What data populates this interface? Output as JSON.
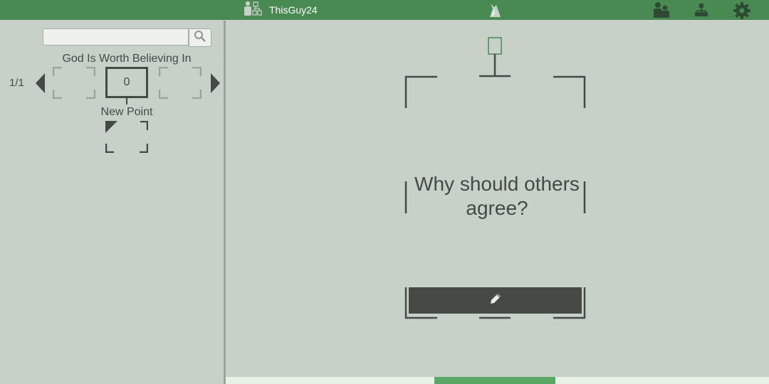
{
  "header": {
    "username": "ThisGuy24",
    "icons": [
      "user-tree-icon",
      "unicorn-icon",
      "people-icon",
      "hierarchy-icon",
      "gear-icon"
    ]
  },
  "sidebar": {
    "search": {
      "value": "",
      "placeholder": ""
    },
    "claim_title": "God Is Worth Believing In",
    "page_count": "1/1",
    "score": "0",
    "new_point_label": "New Point"
  },
  "main": {
    "question": "Why should others agree?"
  },
  "colors": {
    "topbar": "#488a52",
    "background": "#c7d1c8",
    "ink": "#454a45",
    "progress": "#5aa865",
    "progress_track": "#e6f2e6"
  },
  "progress": {
    "fraction": 0.22
  }
}
